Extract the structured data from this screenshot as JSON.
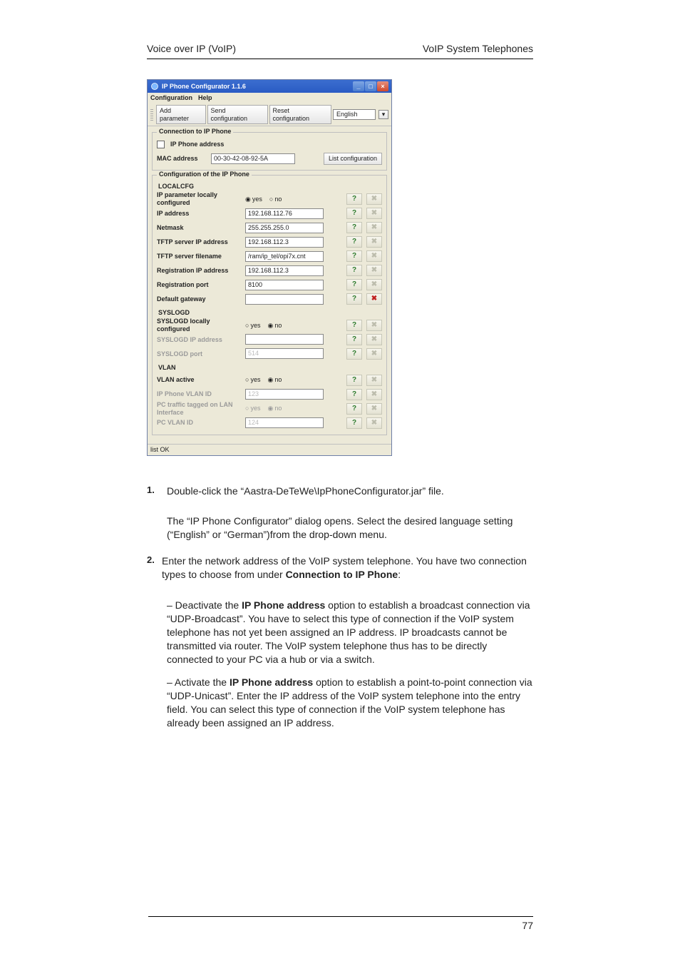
{
  "header": {
    "left": "Voice over IP (VoIP)",
    "right": "VoIP System Telephones"
  },
  "page_number": "77",
  "window": {
    "title": "IP Phone Configurator 1.1.6",
    "menu": {
      "configuration": "Configuration",
      "help": "Help"
    },
    "toolbar": {
      "add_parameter": "Add parameter",
      "send_configuration": "Send configuration",
      "reset_configuration": "Reset configuration",
      "language": "English"
    },
    "connection": {
      "group_title": "Connection to IP Phone",
      "ip_phone_address_label": "IP Phone address",
      "mac_label": "MAC address",
      "mac_value": "00-30-42-08-92-5A",
      "list_config": "List configuration"
    },
    "config": {
      "group_title": "Configuration of the IP Phone",
      "localcfg": "LOCALCFG",
      "rows": [
        {
          "label": "IP parameter locally configured",
          "type": "radio",
          "yes": "yes",
          "no": "no",
          "selected": "yes",
          "del": "dim"
        },
        {
          "label": "IP address",
          "type": "text",
          "value": "192.168.112.76",
          "del": "dim"
        },
        {
          "label": "Netmask",
          "type": "text",
          "value": "255.255.255.0",
          "del": "dim"
        },
        {
          "label": "TFTP server IP address",
          "type": "text",
          "value": "192.168.112.3",
          "del": "dim"
        },
        {
          "label": "TFTP server filename",
          "type": "text",
          "value": "/ram/ip_tel/opi7x.cnt",
          "del": "dim"
        },
        {
          "label": "Registration IP address",
          "type": "text",
          "value": "192.168.112.3",
          "del": "dim"
        },
        {
          "label": "Registration port",
          "type": "text",
          "value": "8100",
          "del": "dim"
        },
        {
          "label": "Default gateway",
          "type": "text",
          "value": "",
          "del": "red"
        }
      ],
      "syslog": {
        "title": "SYSLOGD",
        "rows": [
          {
            "label": "SYSLOGD locally configured",
            "type": "radio",
            "yes": "yes",
            "no": "no",
            "selected": "no",
            "disabled": false,
            "del": "dim"
          },
          {
            "label": "SYSLOGD IP address",
            "type": "text",
            "value": "",
            "disabled": true,
            "del": "dim"
          },
          {
            "label": "SYSLOGD port",
            "type": "text",
            "value": "514",
            "disabled": true,
            "del": "dim"
          }
        ]
      },
      "vlan": {
        "title": "VLAN",
        "rows": [
          {
            "label": "VLAN active",
            "type": "radio",
            "yes": "yes",
            "no": "no",
            "selected": "no",
            "disabled": false,
            "del": "dim"
          },
          {
            "label": "IP Phone VLAN ID",
            "type": "text",
            "value": "123",
            "disabled": true,
            "del": "dim"
          },
          {
            "label": "PC traffic tagged on LAN Interface",
            "type": "radio",
            "yes": "yes",
            "no": "no",
            "selected": "no",
            "disabled": true,
            "del": "dim"
          },
          {
            "label": "PC VLAN ID",
            "type": "text",
            "value": "124",
            "disabled": true,
            "del": "dim"
          }
        ]
      }
    },
    "status": "list OK"
  },
  "steps": {
    "s1_num": "1.",
    "s1": "Double-click the “Aastra-DeTeWe\\IpPhoneConfigurator.jar” file.",
    "s1_after": "The “IP Phone Configurator” dialog opens. Select the desired language setting (“English” or “German”)from the drop-down menu.",
    "s2_num": "2.",
    "s2": "Enter the network address of the VoIP system telephone. You have two connection types to choose from under ",
    "s2_bold": "Connection to IP Phone",
    "s2_tail": ":",
    "p3_a": "– Deactivate the ",
    "p3_bold": "IP Phone address",
    "p3_b": " option to establish a broadcast connection via “UDP-Broadcast”. You have to select this type of connection if the VoIP system telephone has not yet been assigned an IP address. IP broadcasts cannot be transmitted via router. The VoIP system telephone thus has to be directly connected to your PC via a hub or via a switch.",
    "p4_a": "– Activate the ",
    "p4_bold": "IP Phone address",
    "p4_b": " option to establish a point-to-point connection via “UDP-Unicast”. Enter the IP address of the VoIP system telephone into the entry field. You can select this type of connection if the VoIP system telephone has already been assigned an IP address."
  }
}
